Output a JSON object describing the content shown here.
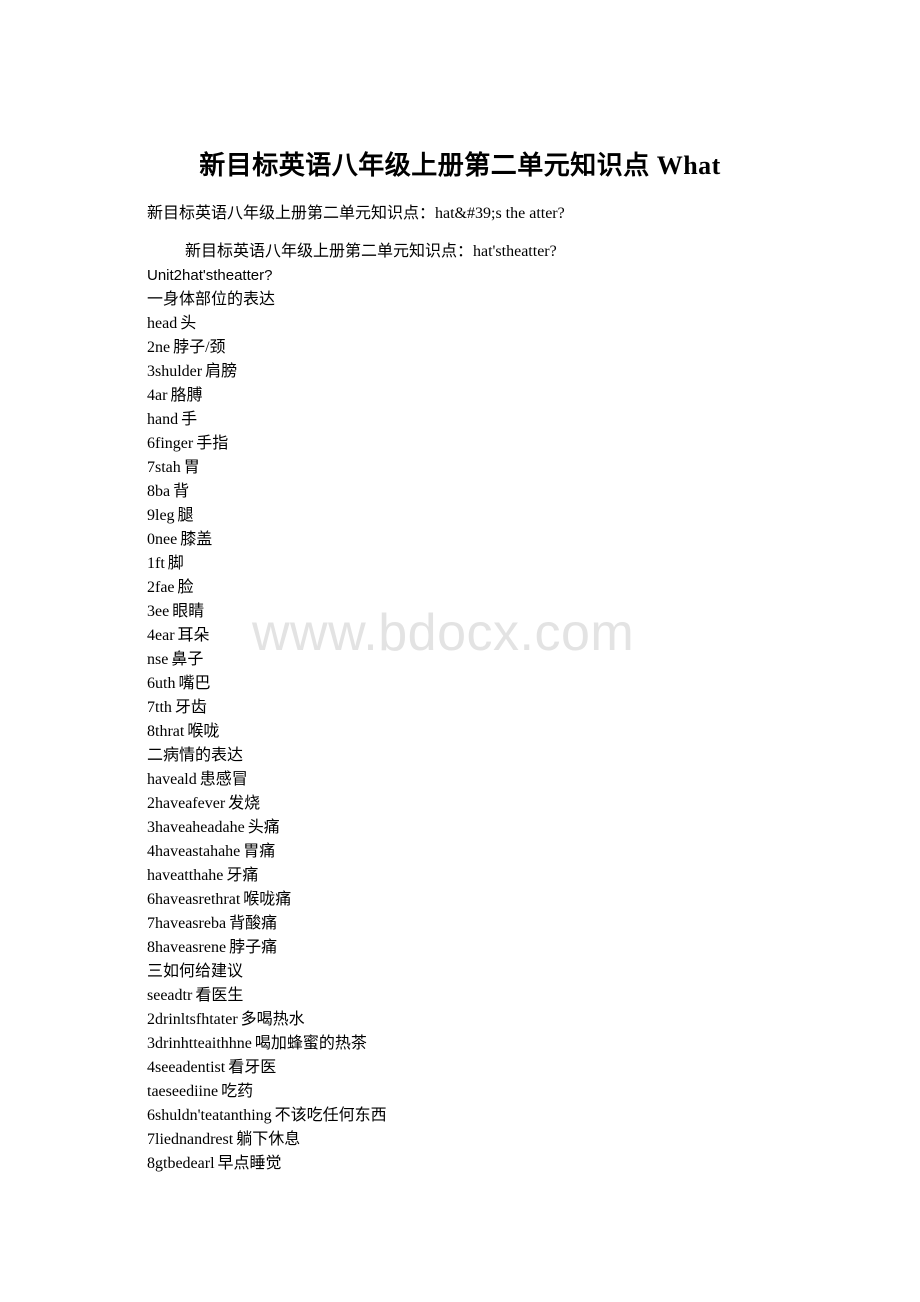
{
  "document": {
    "title": "新目标英语八年级上册第二单元知识点 What",
    "subtitle": "新目标英语八年级上册第二单元知识点：hat&#39;s the atter?",
    "intro_line": "新目标英语八年级上册第二单元知识点：hat'stheatter?",
    "unit_line": "Unit2hat'stheatter?",
    "watermark": "www.bdocx.com",
    "colors": {
      "text": "#000000",
      "watermark": "#e3e3e3",
      "background": "#ffffff"
    },
    "sections": [
      {
        "heading": "一身体部位的表达",
        "items": [
          {
            "en": "head",
            "cn": "头"
          },
          {
            "en": "2ne",
            "cn": "脖子/颈"
          },
          {
            "en": "3shulder",
            "cn": "肩膀"
          },
          {
            "en": "4ar",
            "cn": "胳膊"
          },
          {
            "en": "hand",
            "cn": "手"
          },
          {
            "en": "6finger",
            "cn": "手指"
          },
          {
            "en": "7stah",
            "cn": "胃"
          },
          {
            "en": "8ba",
            "cn": "背"
          },
          {
            "en": "9leg",
            "cn": "腿"
          },
          {
            "en": "0nee",
            "cn": "膝盖"
          },
          {
            "en": "1ft",
            "cn": "脚"
          },
          {
            "en": "2fae",
            "cn": "脸"
          },
          {
            "en": "3ee",
            "cn": "眼睛"
          },
          {
            "en": "4ear",
            "cn": "耳朵"
          },
          {
            "en": "nse",
            "cn": "鼻子"
          },
          {
            "en": "6uth",
            "cn": "嘴巴"
          },
          {
            "en": "7tth",
            "cn": "牙齿"
          },
          {
            "en": "8thrat",
            "cn": "喉咙"
          }
        ]
      },
      {
        "heading": "二病情的表达",
        "items": [
          {
            "en": "haveald",
            "cn": "患感冒"
          },
          {
            "en": "2haveafever",
            "cn": "发烧"
          },
          {
            "en": "3haveaheadahe",
            "cn": "头痛"
          },
          {
            "en": "4haveastahahe",
            "cn": "胃痛"
          },
          {
            "en": "haveatthahe",
            "cn": "牙痛"
          },
          {
            "en": "6haveasrethrat",
            "cn": "喉咙痛"
          },
          {
            "en": "7haveasreba",
            "cn": "背酸痛"
          },
          {
            "en": "8haveasrene",
            "cn": "脖子痛"
          }
        ]
      },
      {
        "heading": "三如何给建议",
        "items": [
          {
            "en": "seeadtr",
            "cn": "看医生"
          },
          {
            "en": "2drinltsfhtater",
            "cn": "多喝热水"
          },
          {
            "en": "3drinhtteaithhne",
            "cn": "喝加蜂蜜的热茶"
          },
          {
            "en": "4seeadentist",
            "cn": "看牙医"
          },
          {
            "en": "taeseediine",
            "cn": "吃药"
          },
          {
            "en": "6shuldn'teatanthing",
            "cn": "不该吃任何东西"
          },
          {
            "en": "7liednandrest",
            "cn": "躺下休息"
          },
          {
            "en": "8gtbedearl",
            "cn": "早点睡觉"
          }
        ]
      }
    ]
  }
}
